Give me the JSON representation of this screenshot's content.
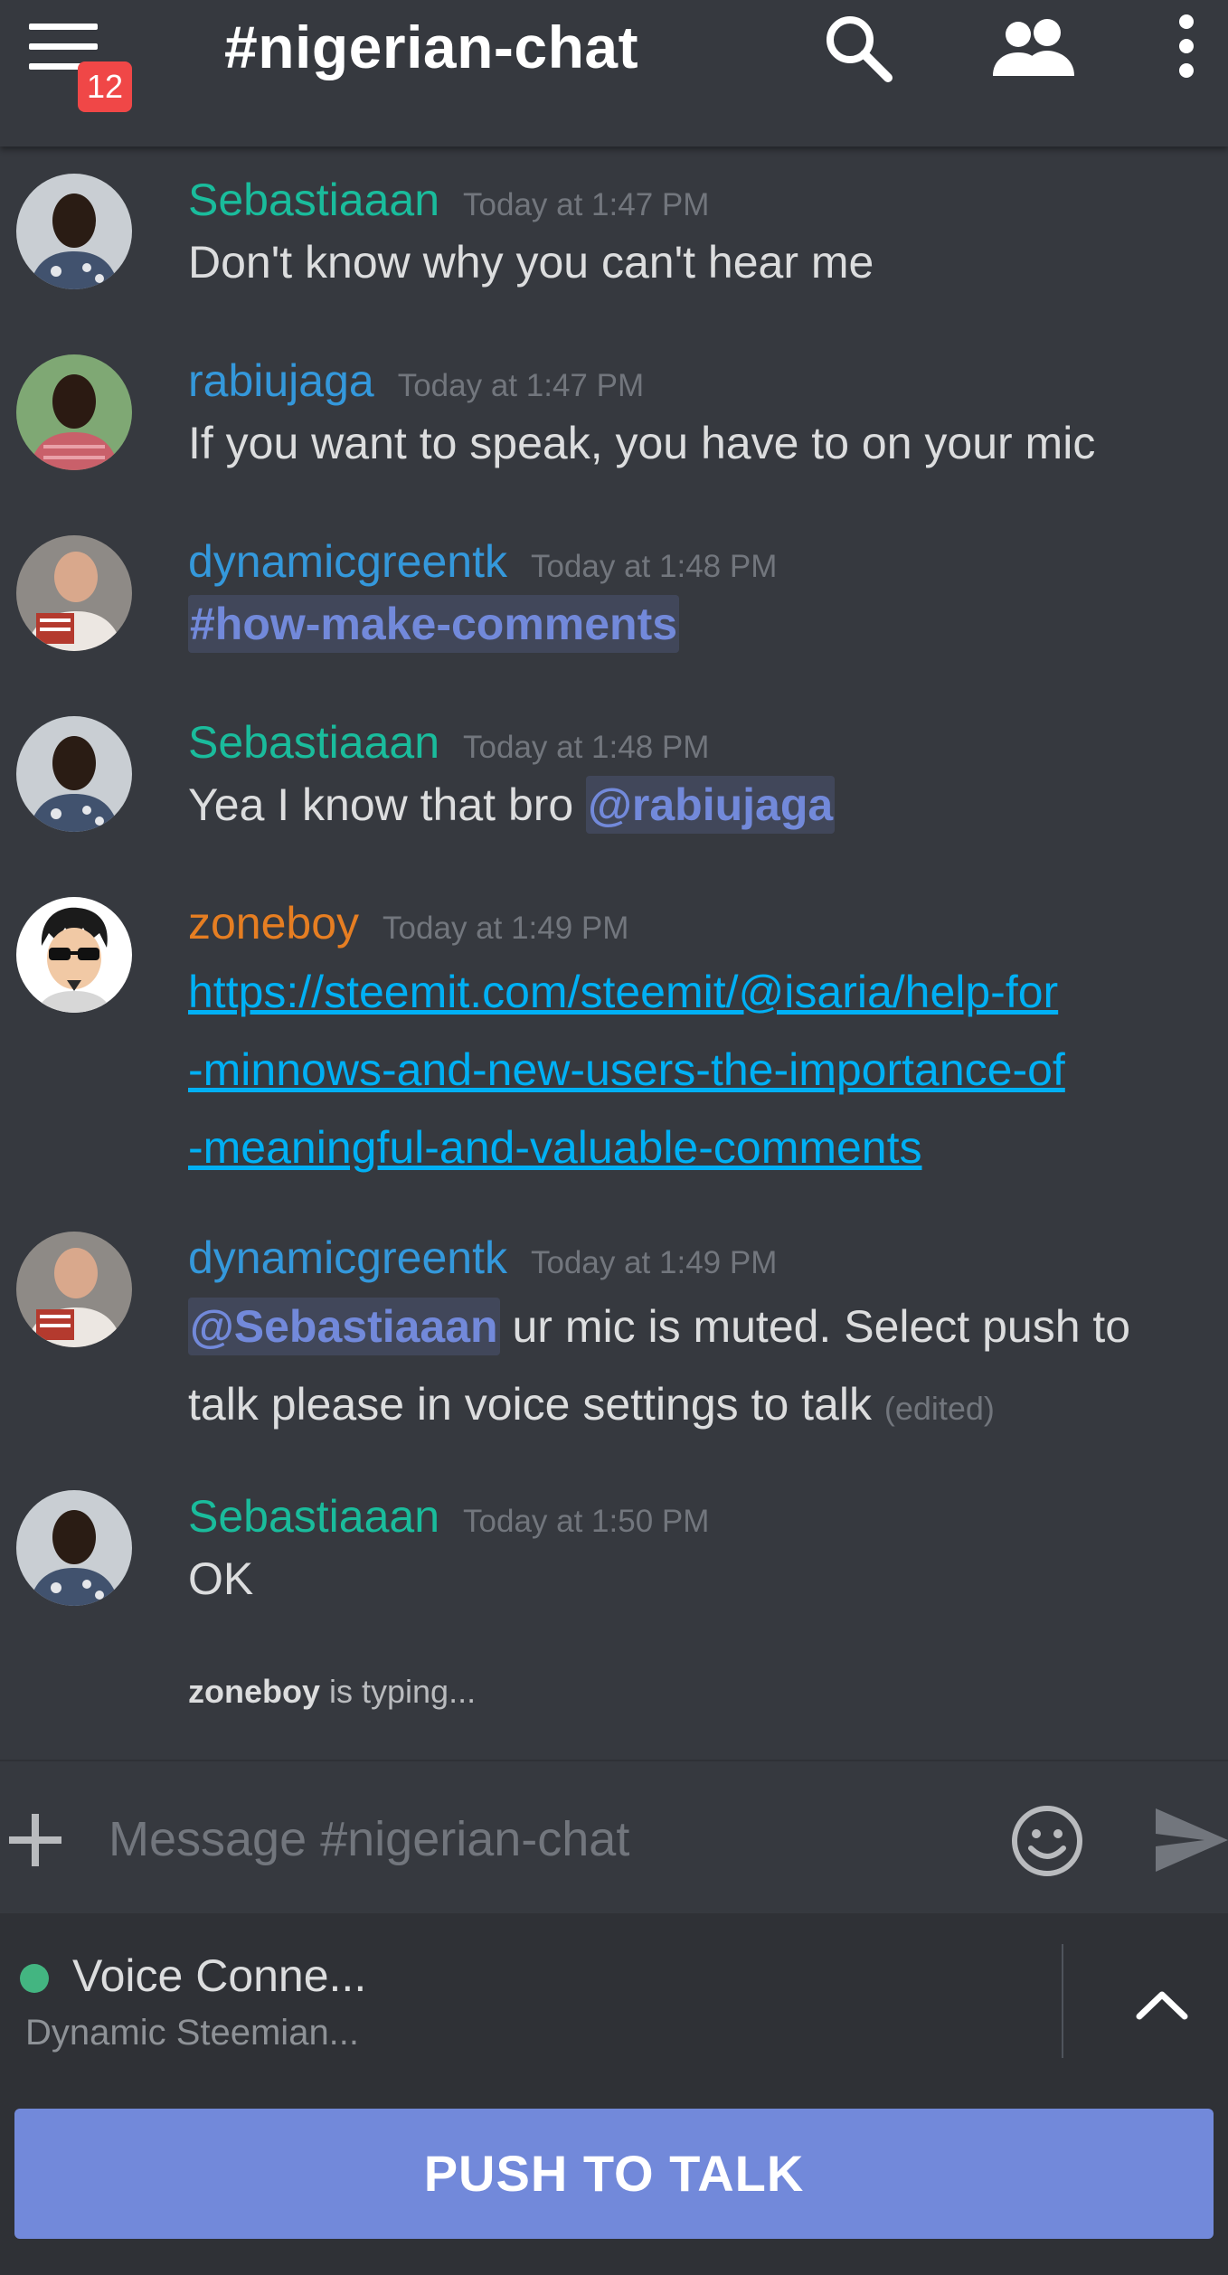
{
  "header": {
    "title": "#nigerian-chat",
    "unread_badge": "12",
    "icons": [
      "hamburger-menu-icon",
      "search-icon",
      "members-icon",
      "more-vertical-icon"
    ]
  },
  "colors": {
    "background": "#36393f",
    "secondary_background": "#2f3136",
    "accent_blurple": "#7289da",
    "user_green": "#1abc9c",
    "user_blue": "#3498db",
    "user_orange": "#e67e22",
    "link": "#00b0f4",
    "badge_red": "#f04747",
    "online_green": "#43b581"
  },
  "messages": [
    {
      "author": "Sebastiaaan",
      "timestamp": "Today at 1:47 PM",
      "text": "Don't know why you can't hear me"
    },
    {
      "author": "rabiujaga",
      "timestamp": "Today at 1:47 PM",
      "text": "If you want to speak, you have to on your mic"
    },
    {
      "author": "dynamicgreentk",
      "timestamp": "Today at 1:48 PM",
      "channel_mention": "#how-make-comments"
    },
    {
      "author": "Sebastiaaan",
      "timestamp": "Today at 1:48 PM",
      "text": "Yea I know that bro ",
      "mention": "@rabiujaga"
    },
    {
      "author": "zoneboy",
      "timestamp": "Today at 1:49 PM",
      "link_lines": [
        "https://steemit.com/steemit/@isaria/help-for",
        "-minnows-and-new-users-the-importance-of",
        "-meaningful-and-valuable-comments"
      ]
    },
    {
      "author": "dynamicgreentk",
      "timestamp": "Today at 1:49 PM",
      "mention": "@Sebastiaaan",
      "text_line1": " ur mic is muted. Select push to",
      "text_line2": "talk please in voice settings to talk ",
      "edited": "(edited)"
    },
    {
      "author": "Sebastiaaan",
      "timestamp": "Today at 1:50 PM",
      "text": "OK"
    }
  ],
  "typing": {
    "user": "zoneboy",
    "suffix": " is typing..."
  },
  "composer": {
    "placeholder": "Message #nigerian-chat",
    "value": ""
  },
  "voice": {
    "status": "Voice Conne...",
    "channel": "Dynamic Steemian..."
  },
  "ptt": {
    "label": "PUSH TO TALK"
  }
}
